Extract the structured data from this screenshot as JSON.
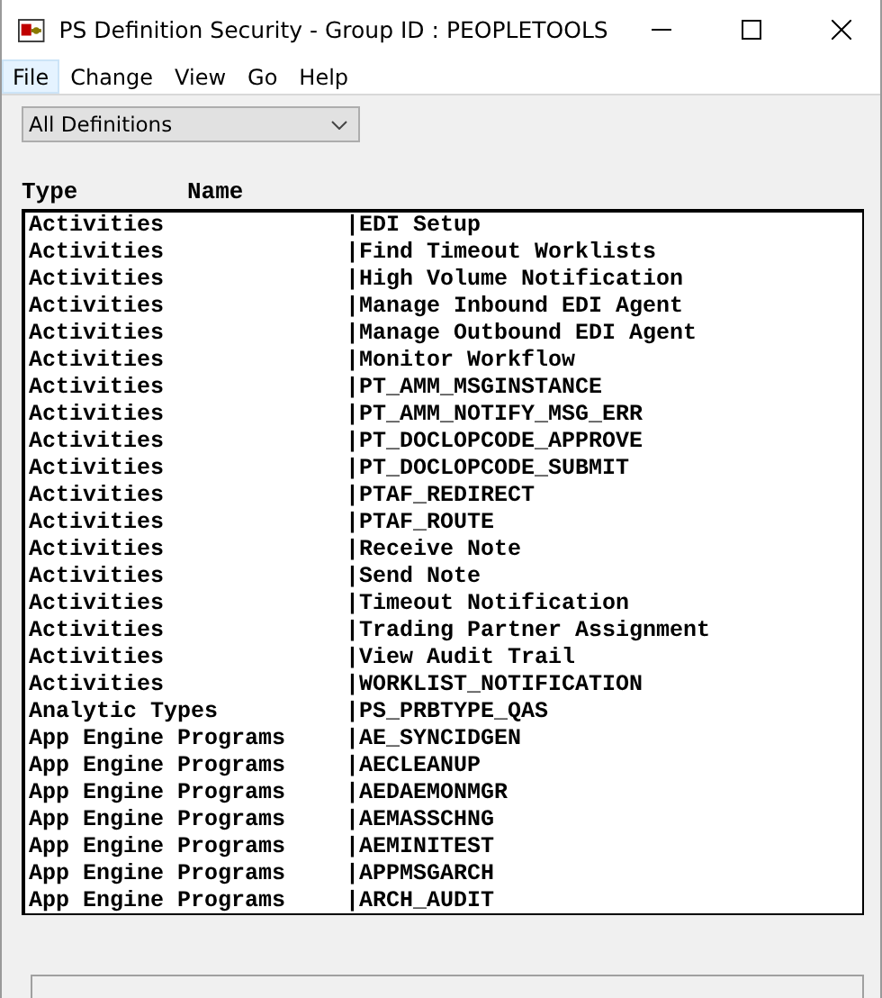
{
  "window": {
    "title": "PS Definition Security - Group ID : PEOPLETOOLS"
  },
  "menu": [
    {
      "label": "File",
      "selected": true
    },
    {
      "label": "Change",
      "selected": false
    },
    {
      "label": "View",
      "selected": false
    },
    {
      "label": "Go",
      "selected": false
    },
    {
      "label": "Help",
      "selected": false
    }
  ],
  "filter": {
    "value": "All Definitions"
  },
  "list": {
    "columns": [
      "Type",
      "Name"
    ],
    "rows": [
      {
        "type": "Activities",
        "name": "|EDI Setup"
      },
      {
        "type": "Activities",
        "name": "|Find Timeout Worklists"
      },
      {
        "type": "Activities",
        "name": "|High Volume Notification"
      },
      {
        "type": "Activities",
        "name": "|Manage Inbound EDI Agent"
      },
      {
        "type": "Activities",
        "name": "|Manage Outbound EDI Agent"
      },
      {
        "type": "Activities",
        "name": "|Monitor Workflow"
      },
      {
        "type": "Activities",
        "name": "|PT_AMM_MSGINSTANCE"
      },
      {
        "type": "Activities",
        "name": "|PT_AMM_NOTIFY_MSG_ERR"
      },
      {
        "type": "Activities",
        "name": "|PT_DOCLOPCODE_APPROVE"
      },
      {
        "type": "Activities",
        "name": "|PT_DOCLOPCODE_SUBMIT"
      },
      {
        "type": "Activities",
        "name": "|PTAF_REDIRECT"
      },
      {
        "type": "Activities",
        "name": "|PTAF_ROUTE"
      },
      {
        "type": "Activities",
        "name": "|Receive Note"
      },
      {
        "type": "Activities",
        "name": "|Send Note"
      },
      {
        "type": "Activities",
        "name": "|Timeout Notification"
      },
      {
        "type": "Activities",
        "name": "|Trading Partner Assignment"
      },
      {
        "type": "Activities",
        "name": "|View Audit Trail"
      },
      {
        "type": "Activities",
        "name": "|WORKLIST_NOTIFICATION"
      },
      {
        "type": "Analytic Types",
        "name": "|PS_PRBTYPE_QAS"
      },
      {
        "type": "App Engine Programs",
        "name": "|AE_SYNCIDGEN"
      },
      {
        "type": "App Engine Programs",
        "name": "|AECLEANUP"
      },
      {
        "type": "App Engine Programs",
        "name": "|AEDAEMONMGR"
      },
      {
        "type": "App Engine Programs",
        "name": "|AEMASSCHNG"
      },
      {
        "type": "App Engine Programs",
        "name": "|AEMINITEST"
      },
      {
        "type": "App Engine Programs",
        "name": "|APPMSGARCH"
      },
      {
        "type": "App Engine Programs",
        "name": "|ARCH_AUDIT"
      }
    ]
  }
}
